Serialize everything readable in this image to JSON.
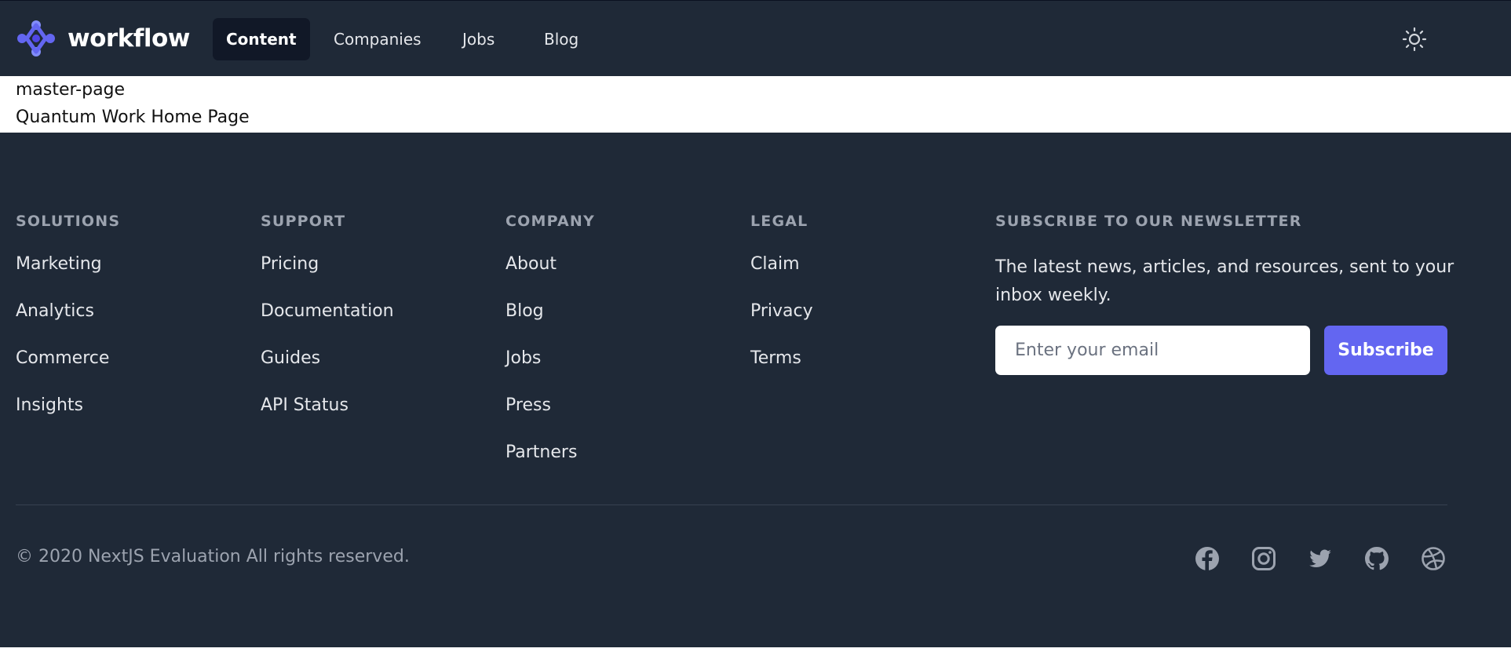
{
  "brand": {
    "name": "workflow",
    "accent": "#6366f1"
  },
  "nav": {
    "links": [
      "Content",
      "Companies",
      "Jobs",
      "Blog"
    ],
    "active": "Content",
    "theme_icon": "sun-icon"
  },
  "content": {
    "line1": "master-page",
    "line2": "Quantum Work Home Page"
  },
  "footer": {
    "columns": [
      {
        "heading": "SOLUTIONS",
        "links": [
          "Marketing",
          "Analytics",
          "Commerce",
          "Insights"
        ]
      },
      {
        "heading": "SUPPORT",
        "links": [
          "Pricing",
          "Documentation",
          "Guides",
          "API Status"
        ]
      },
      {
        "heading": "COMPANY",
        "links": [
          "About",
          "Blog",
          "Jobs",
          "Press",
          "Partners"
        ]
      },
      {
        "heading": "LEGAL",
        "links": [
          "Claim",
          "Privacy",
          "Terms"
        ]
      }
    ],
    "newsletter": {
      "heading": "SUBSCRIBE TO OUR NEWSLETTER",
      "text": "The latest news, articles, and resources, sent to your inbox weekly.",
      "placeholder": "Enter your email",
      "button": "Subscribe"
    },
    "copyright": "© 2020 NextJS Evaluation All rights reserved.",
    "social": [
      "facebook-icon",
      "instagram-icon",
      "twitter-icon",
      "github-icon",
      "dribbble-icon"
    ]
  },
  "colors": {
    "background": "#1f2937",
    "active_nav": "#111827",
    "muted": "#9ca3af"
  }
}
